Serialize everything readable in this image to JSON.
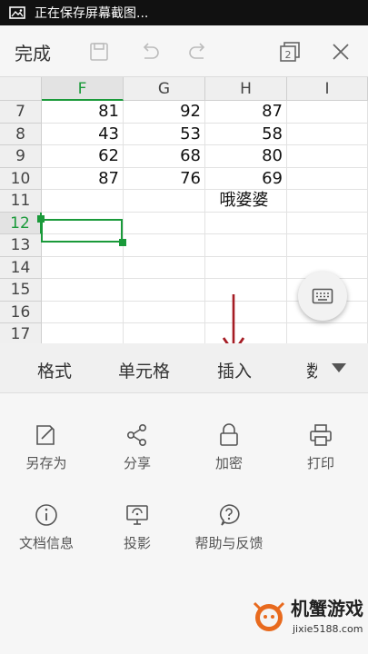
{
  "status_bar": {
    "notification_text": "正在保存屏幕截图..."
  },
  "toolbar": {
    "done_label": "完成",
    "window_count": "2"
  },
  "sheet": {
    "columns": [
      "F",
      "G",
      "H",
      "I"
    ],
    "selected_column": "F",
    "rows": [
      {
        "num": "7",
        "cells": [
          "81",
          "92",
          "87",
          ""
        ]
      },
      {
        "num": "8",
        "cells": [
          "43",
          "53",
          "58",
          ""
        ]
      },
      {
        "num": "9",
        "cells": [
          "62",
          "68",
          "80",
          ""
        ]
      },
      {
        "num": "10",
        "cells": [
          "87",
          "76",
          "69",
          ""
        ]
      },
      {
        "num": "11",
        "cells": [
          "",
          "",
          "哦婆婆",
          ""
        ]
      },
      {
        "num": "12",
        "cells": [
          "",
          "",
          "",
          ""
        ]
      },
      {
        "num": "13",
        "cells": [
          "",
          "",
          "",
          ""
        ]
      },
      {
        "num": "14",
        "cells": [
          "",
          "",
          "",
          ""
        ]
      },
      {
        "num": "15",
        "cells": [
          "",
          "",
          "",
          ""
        ]
      },
      {
        "num": "16",
        "cells": [
          "",
          "",
          "",
          ""
        ]
      },
      {
        "num": "17",
        "cells": [
          "",
          "",
          "",
          ""
        ]
      }
    ],
    "selected_cell": "F12"
  },
  "tabs": [
    "格式",
    "单元格",
    "插入",
    "数"
  ],
  "menu_items": [
    {
      "label": "另存为",
      "icon": "save-as-icon"
    },
    {
      "label": "分享",
      "icon": "share-icon"
    },
    {
      "label": "加密",
      "icon": "lock-icon"
    },
    {
      "label": "打印",
      "icon": "printer-icon"
    },
    {
      "label": "文档信息",
      "icon": "info-icon"
    },
    {
      "label": "投影",
      "icon": "projection-icon"
    },
    {
      "label": "帮助与反馈",
      "icon": "help-icon"
    }
  ],
  "watermark": {
    "brand": "机蟹游戏",
    "site": "jixie5188.com"
  },
  "colors": {
    "accent_green": "#1a9a3a",
    "arrow_red": "#a51c24"
  }
}
